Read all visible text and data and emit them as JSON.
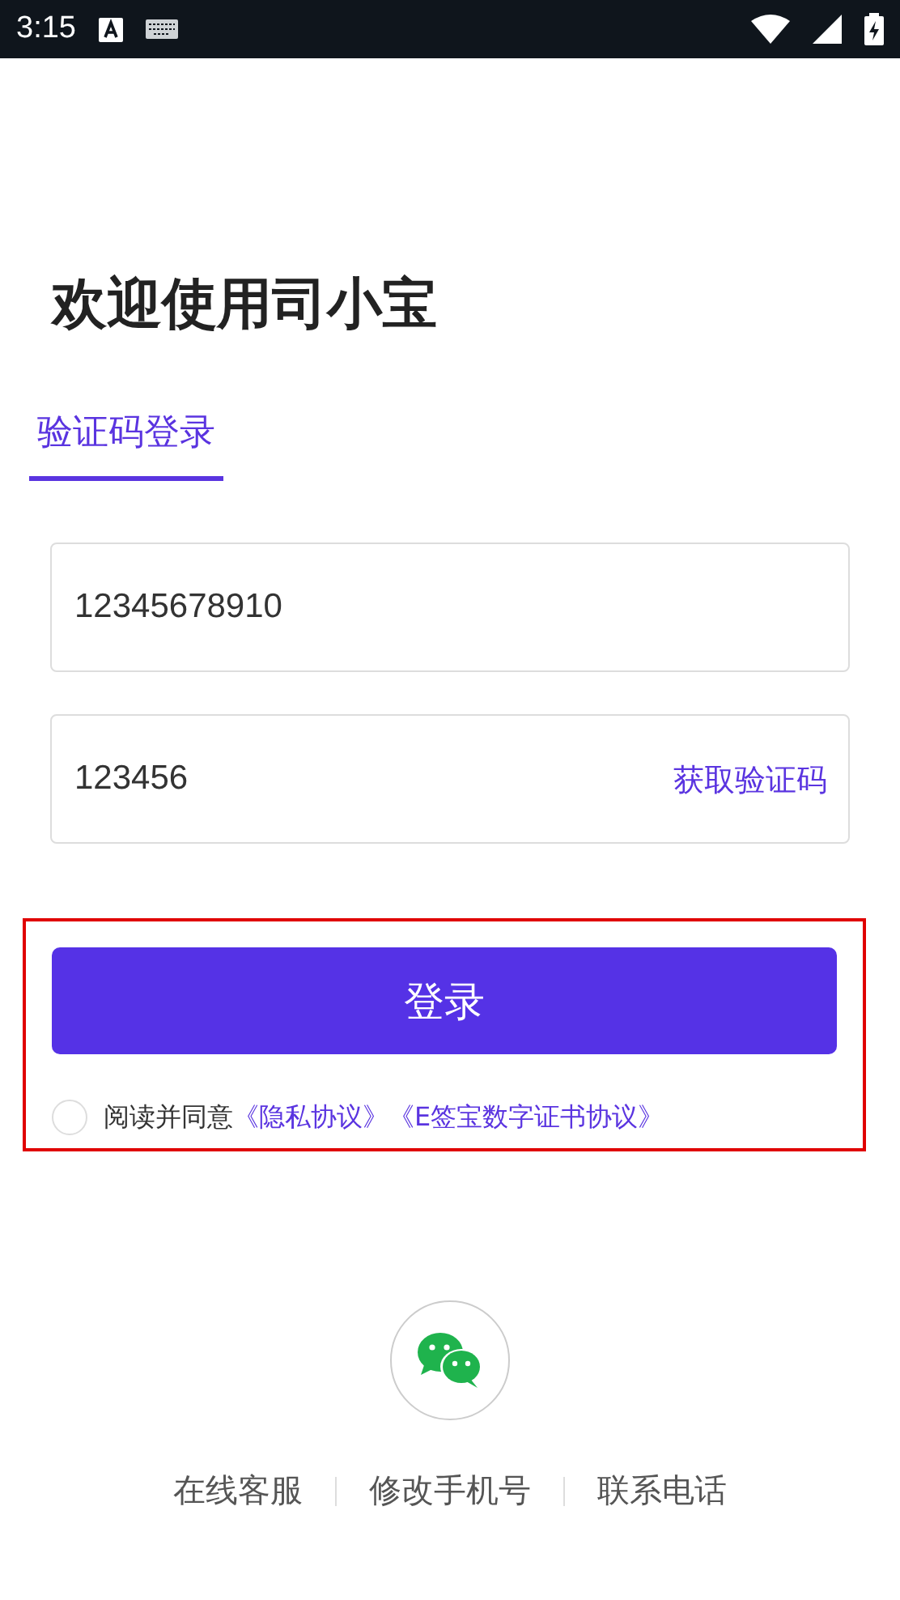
{
  "status_bar": {
    "time": "3:15"
  },
  "title": "欢迎使用司小宝",
  "tabs": [
    {
      "label": "验证码登录",
      "selected": true
    }
  ],
  "phone_field": {
    "value": "12345678910"
  },
  "code_field": {
    "value": "123456",
    "action": "获取验证码"
  },
  "login_section": {
    "highlighted": true,
    "button": "登录",
    "agreement": {
      "checked": false,
      "text": "阅读并同意",
      "links": [
        "《隐私协议》",
        "《E签宝数字证书协议》"
      ]
    }
  },
  "footer_links": [
    "在线客服",
    "修改手机号",
    "联系电话"
  ]
}
